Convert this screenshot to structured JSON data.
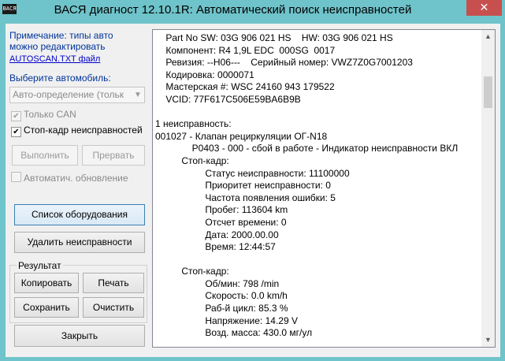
{
  "window": {
    "app_icon_text": "ВАСЯ",
    "title": "ВАСЯ диагност 12.10.1R:  Автоматический поиск неисправностей",
    "close_glyph": "✕"
  },
  "sidebar": {
    "note": "Примечание: типы авто\nможно редактировать",
    "note_link": "AUTOSCAN.TXT файл",
    "select_label": "Выберите автомобиль:",
    "combo_value": "Авто-определение (тольк",
    "only_can": {
      "label": "Только CAN",
      "checked": true
    },
    "freeze_frame": {
      "label": "Стоп-кадр неисправностей",
      "checked": true
    },
    "run_button": "Выполнить",
    "stop_button": "Прервать",
    "auto_refresh": {
      "label": "Автоматич. обновление",
      "checked": false
    },
    "equipment_button": "Список оборудования",
    "delete_faults_button": "Удалить неисправности",
    "result_group": {
      "label": "Результат",
      "copy_button": "Копировать",
      "print_button": "Печать",
      "save_button": "Сохранить",
      "clear_button": "Очистить"
    },
    "close_button": "Закрыть"
  },
  "log": {
    "lines": [
      "    Part No SW: 03G 906 021 HS    HW: 03G 906 021 HS",
      "    Компонент: R4 1,9L EDC  000SG  0017",
      "    Ревизия: --H06---    Серийный номер: VWZ7Z0G7001203",
      "    Кодировка: 0000071",
      "    Мастерская #: WSC 24160 943 179522",
      "    VCID: 77F617C506E59BA6B9B",
      "",
      "1 неисправность:",
      "001027 - Клапан рециркуляции ОГ-N18",
      "              P0403 - 000 - сбой в работе - Индикатор неисправности ВКЛ",
      "          Стоп-кадр:",
      "                   Статус неисправности: 11100000",
      "                   Приоритет неисправности: 0",
      "                   Частота появления ошибки: 5",
      "                   Пробег: 113604 km",
      "                   Отсчет времени: 0",
      "                   Дата: 2000.00.00",
      "                   Время: 12:44:57",
      "",
      "          Стоп-кадр:",
      "                   Об/мин: 798 /min",
      "                   Скорость: 0.0 km/h",
      "                   Раб-й цикл: 85.3 %",
      "                   Напряжение: 14.29 V",
      "                   Возд. масса: 430.0 мг/ул"
    ]
  }
}
